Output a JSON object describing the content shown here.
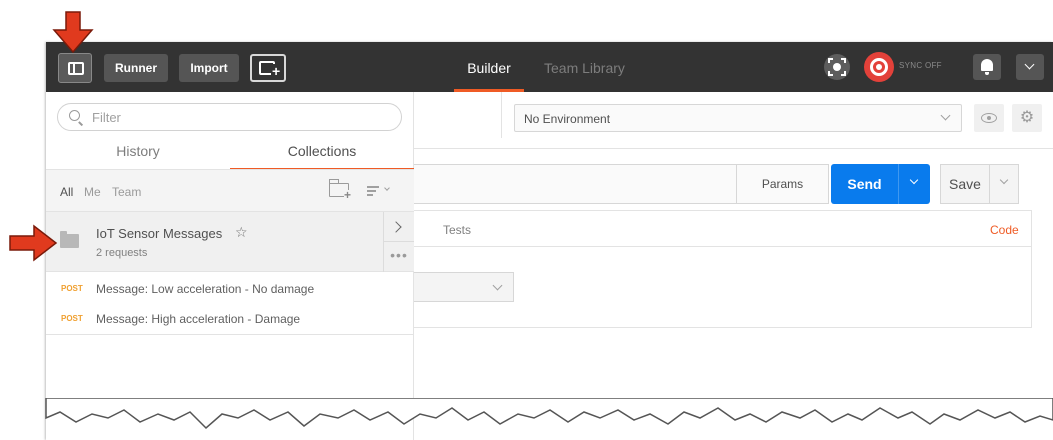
{
  "toolbar": {
    "runner_label": "Runner",
    "import_label": "Import"
  },
  "tabs": {
    "builder": "Builder",
    "team_library": "Team Library"
  },
  "sync": {
    "label": "SYNC OFF",
    "color": "#e3413a"
  },
  "sidebar": {
    "filter_placeholder": "Filter",
    "tabs": [
      "History",
      "Collections"
    ],
    "active_tab": "Collections",
    "owner_filters": [
      "All",
      "Me",
      "Team"
    ],
    "collections": [
      {
        "name": "IoT Sensor Messages",
        "count": "2 requests"
      }
    ],
    "requests": [
      {
        "method": "POST",
        "name": "Message: Low acceleration - No damage"
      },
      {
        "method": "POST",
        "name": "Message: High acceleration - Damage"
      }
    ]
  },
  "environment": {
    "selected": "No Environment"
  },
  "request": {
    "params_label": "Params",
    "send_label": "Send",
    "save_label": "Save",
    "tests_tab": "Tests",
    "code_link": "Code"
  },
  "colors": {
    "accent": "#ef5b25",
    "send": "#097bed",
    "topbar": "#333333",
    "arrow": "#e03a1e"
  }
}
